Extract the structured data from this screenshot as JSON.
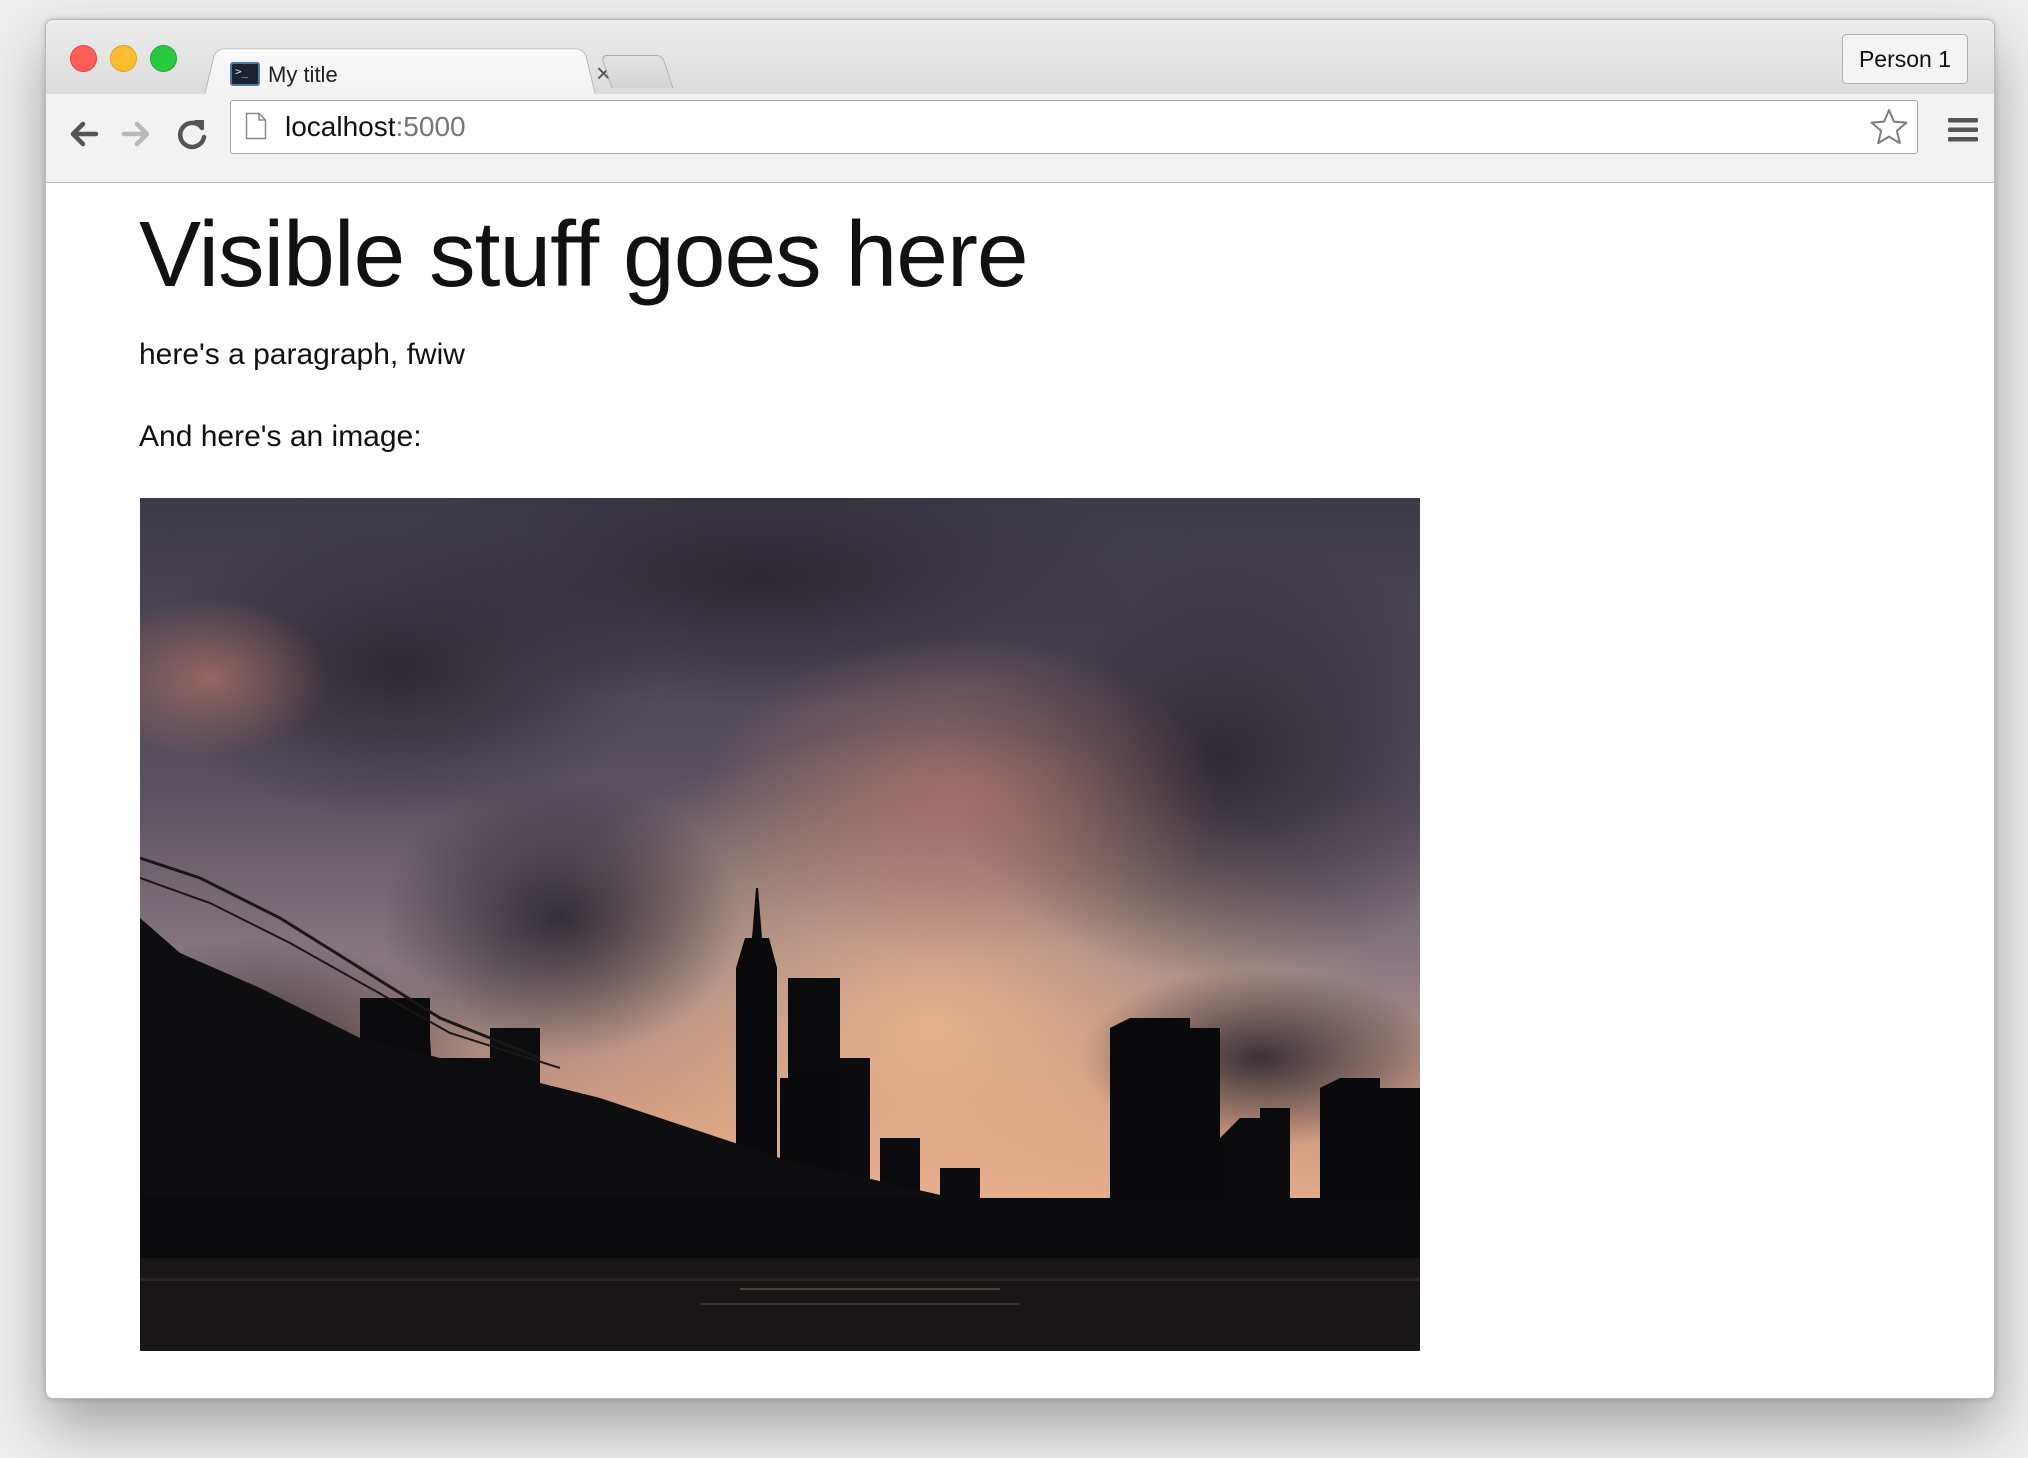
{
  "browser": {
    "tab": {
      "title": "My title",
      "close_label": "×"
    },
    "profile_label": "Person 1",
    "address": {
      "host": "localhost",
      "port": ":5000"
    }
  },
  "page": {
    "heading": "Visible stuff goes here",
    "paragraphs": [
      "here's a paragraph, fwiw",
      "And here's an image:"
    ]
  },
  "colors": {
    "close": "#fc5f57",
    "minimize": "#fdbc2e",
    "zoom": "#28c840"
  },
  "icons": [
    "back-arrow-icon",
    "forward-arrow-icon",
    "reload-icon",
    "page-icon",
    "bookmark-star-icon",
    "menu-icon",
    "terminal-favicon-icon"
  ]
}
